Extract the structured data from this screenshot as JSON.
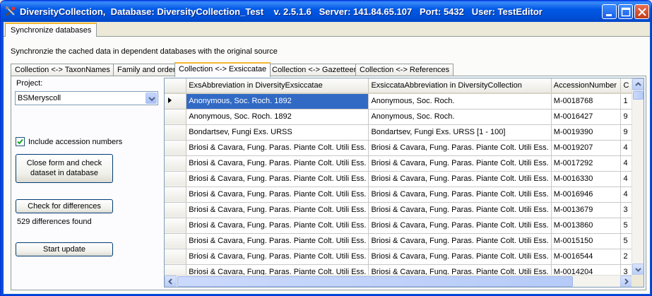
{
  "window": {
    "title": "DiversityCollection,  Database: DiversityCollection_Test    v. 2.5.1.6   Server: 141.84.65.107   Port: 5432   User: TestEditor"
  },
  "top_tab": {
    "label": "Synchronize databases"
  },
  "description": "Synchronzie the cached data in dependent databases with the original source",
  "sub_tabs": [
    {
      "label": "Collection <-> TaxonNames"
    },
    {
      "label": "Family and order"
    },
    {
      "label": "Collection <-> Exsiccatae",
      "active": true
    },
    {
      "label": "Collection <-> Gazetteer"
    },
    {
      "label": "Collection <-> References"
    }
  ],
  "left_panel": {
    "project_label": "Project:",
    "project_value": "BSMeryscoll",
    "include_accession_label": "Include accession numbers",
    "include_accession_checked": true,
    "close_form_button": "Close form and check dataset in database",
    "check_differences_button": "Check for differences",
    "differences_found": "529 differences found",
    "start_update_button": "Start update"
  },
  "grid": {
    "columns": [
      "ExsAbbreviation in DiversityExsiccatae",
      "ExsiccataAbbreviation in DiversityCollection",
      "AccessionNumber",
      "C"
    ],
    "rows": [
      [
        "Anonymous, Soc. Roch. 1892",
        "Anonymous, Soc. Roch.",
        "M-0018768",
        "1"
      ],
      [
        "Anonymous, Soc. Roch. 1892",
        "Anonymous, Soc. Roch.",
        "M-0016427",
        "9"
      ],
      [
        "Bondartsev, Fungi Exs. URSS",
        "Bondartsev, Fungi Exs. URSS [1 - 100]",
        "M-0019390",
        "9"
      ],
      [
        "Briosi & Cavara, Fung. Paras. Piante Colt. Utili Ess.",
        "Briosi & Cavara, Fung. Paras. Piante Colt. Utili  Ess.",
        "M-0019207",
        "4"
      ],
      [
        "Briosi & Cavara, Fung. Paras. Piante Colt. Utili Ess.",
        "Briosi & Cavara, Fung. Paras. Piante Colt. Utili  Ess.",
        "M-0017292",
        "4"
      ],
      [
        "Briosi & Cavara, Fung. Paras. Piante Colt. Utili Ess.",
        "Briosi & Cavara, Fung. Paras. Piante Colt. Utili  Ess.",
        "M-0016330",
        "4"
      ],
      [
        "Briosi & Cavara, Fung. Paras. Piante Colt. Utili Ess.",
        "Briosi & Cavara, Fung. Paras. Piante Colt. Utili  Ess.",
        "M-0016946",
        "4"
      ],
      [
        "Briosi & Cavara, Fung. Paras. Piante Colt. Utili Ess.",
        "Briosi & Cavara, Fung. Paras. Piante Colt. Utili  Ess.",
        "M-0013679",
        "3"
      ],
      [
        "Briosi & Cavara, Fung. Paras. Piante Colt. Utili Ess.",
        "Briosi & Cavara, Fung. Paras. Piante Colt. Utili  Ess.",
        "M-0013860",
        "5"
      ],
      [
        "Briosi & Cavara, Fung. Paras. Piante Colt. Utili Ess.",
        "Briosi & Cavara, Fung. Paras. Piante Colt. Utili  Ess.",
        "M-0015150",
        "5"
      ],
      [
        "Briosi & Cavara, Fung. Paras. Piante Colt. Utili Ess.",
        "Briosi & Cavara, Fung. Paras. Piante Colt. Utili  Ess.",
        "M-0016544",
        "2"
      ],
      [
        "Briosi & Cavara, Fung. Paras. Piante Colt. Utili Ess.",
        "Briosi & Cavara, Fung. Paras. Piante Colt. Utili  Ess.",
        "M-0014204",
        "3"
      ]
    ],
    "selected_row": 0
  },
  "icons": {
    "app": "tools-icon",
    "minimize": "minimize-icon",
    "maximize": "maximize-icon",
    "close": "close-icon",
    "combo_drop": "chevron-down-icon",
    "row_pointer": "current-row-arrow-icon"
  },
  "colors": {
    "titlebar": "#0058e6",
    "tab_highlight": "#f4b632",
    "selection": "#316ac5"
  }
}
